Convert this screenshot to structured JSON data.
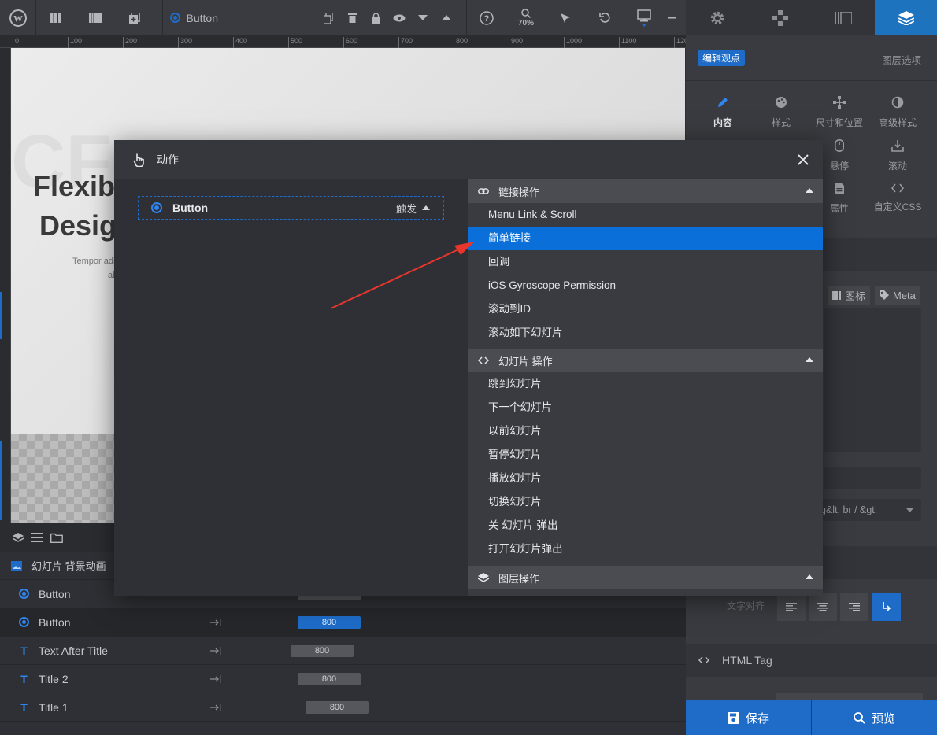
{
  "toolbar": {
    "layer_name": "Button",
    "zoom": "70%"
  },
  "ruler": {
    "marks": [
      "0",
      "100",
      "200",
      "300",
      "400",
      "500",
      "600",
      "700",
      "800",
      "900",
      "1000",
      "1100",
      "120"
    ]
  },
  "canvas": {
    "hero_line1": "Flexib",
    "hero_line2": "Desig",
    "sub_text1": "Tempor adi",
    "sub_text2": "al"
  },
  "right_panel": {
    "edit_view_badge": "编辑观点",
    "layer_options": "图层选项",
    "subtabs": [
      {
        "label": "内容",
        "icon": "pencil-icon"
      },
      {
        "label": "样式",
        "icon": "palette-icon"
      },
      {
        "label": "尺寸和位置",
        "icon": "move-icon"
      },
      {
        "label": "高级样式",
        "icon": "contrast-icon"
      }
    ],
    "subtabs2": [
      {
        "label": "悬停",
        "icon": "mouse-icon"
      },
      {
        "label": "滚动",
        "icon": "scroll-icon"
      }
    ],
    "subtabs3": [
      {
        "label": "属性",
        "icon": "file-icon"
      },
      {
        "label": "自定义CSS",
        "icon": "code-icon"
      }
    ],
    "chip_icon": "图标",
    "chip_meta": "Meta",
    "br_text": "g&lt; br / &gt;",
    "text_align_label": "文字对齐",
    "html_tag_label": "HTML Tag",
    "save_label": "保存",
    "preview_label": "预览"
  },
  "timeline": {
    "slide_bg_label": "幻灯片 背景动画",
    "rows": [
      {
        "label": "Button",
        "type": "button",
        "bar": ""
      },
      {
        "label": "Button",
        "type": "button",
        "bar": "800"
      },
      {
        "label": "Text After Title",
        "type": "text",
        "bar": "800"
      },
      {
        "label": "Title 2",
        "type": "text",
        "bar": "800"
      },
      {
        "label": "Title 1",
        "type": "text",
        "bar": "800"
      }
    ]
  },
  "modal": {
    "title": "动作",
    "layer_label": "Button",
    "trigger_label": "触发",
    "groups": [
      {
        "title": "链接操作",
        "icon": "link-icon",
        "items": [
          "Menu Link & Scroll",
          "简单链接",
          "回调",
          "iOS Gyroscope Permission",
          "滚动到ID",
          "滚动如下幻灯片"
        ]
      },
      {
        "title": "幻灯片 操作",
        "icon": "code-icon",
        "items": [
          "跳到幻灯片",
          "下一个幻灯片",
          "以前幻灯片",
          "暂停幻灯片",
          "播放幻灯片",
          "切换幻灯片",
          "关 幻灯片 弹出",
          "打开幻灯片弹出"
        ]
      },
      {
        "title": "图层操作",
        "icon": "layers-icon",
        "items": []
      }
    ],
    "selected_item": "简单链接"
  },
  "colors": {
    "accent": "#1e6cc8",
    "selected": "#0a6fd8",
    "arrow": "#e8362d"
  }
}
